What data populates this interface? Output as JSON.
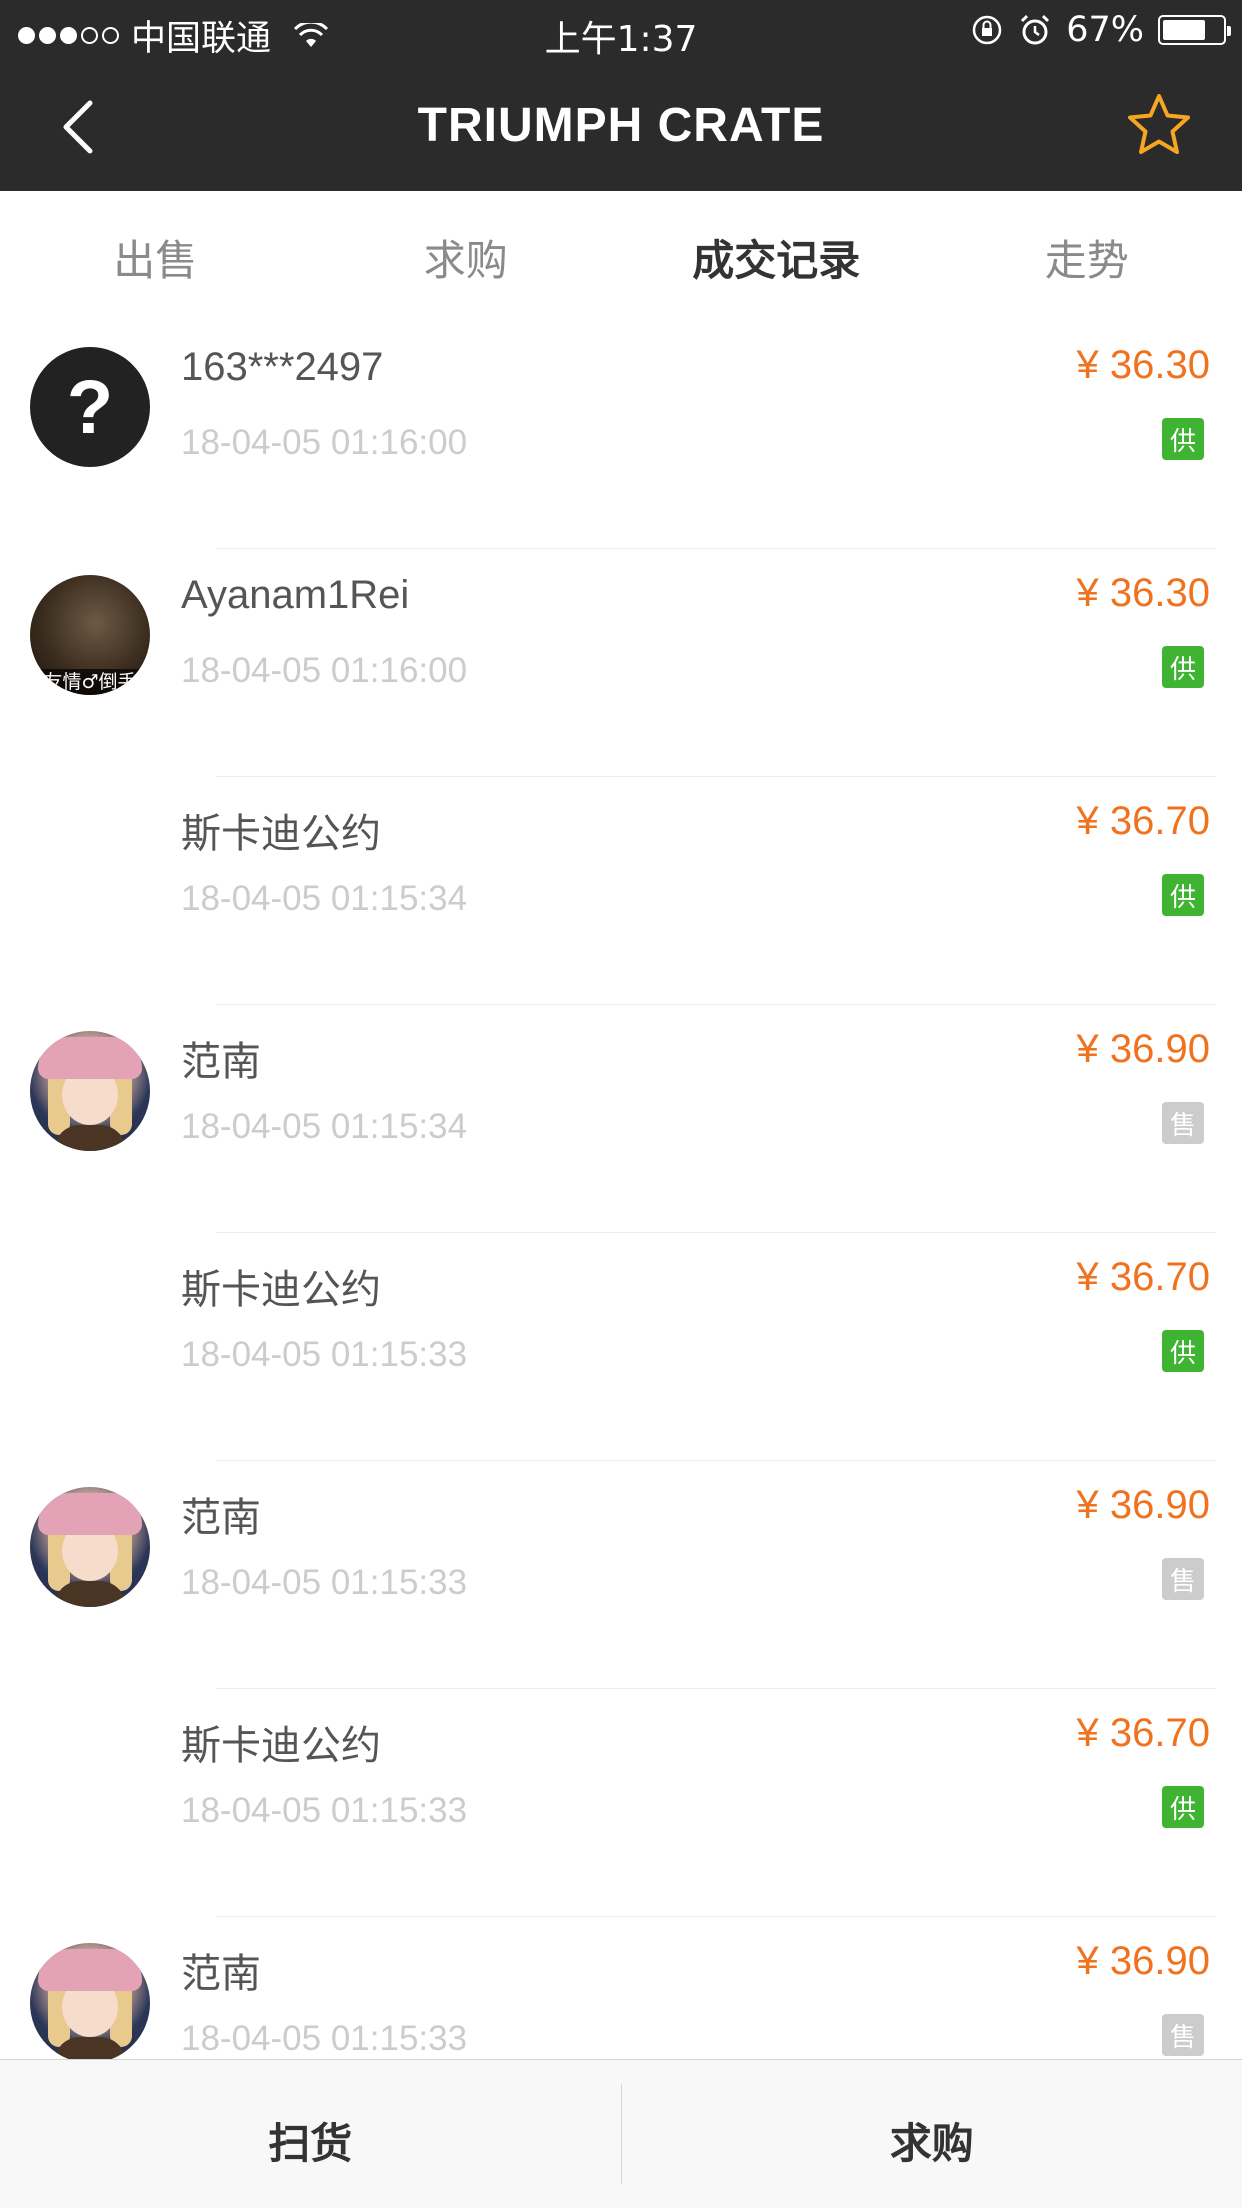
{
  "status_bar": {
    "carrier": "中国联通",
    "time": "上午1:37",
    "battery": "67%",
    "battery_level": 0.67,
    "signal_bars_filled": 3,
    "signal_bars_total": 5,
    "icons": [
      "wifi-icon",
      "rotation-lock-icon",
      "alarm-icon",
      "battery-icon"
    ]
  },
  "nav": {
    "title": "TRIUMPH CRATE",
    "back_icon": "chevron-left-icon",
    "favorite_icon": "star-outline-icon",
    "star_color": "#f5a623"
  },
  "tabs": [
    {
      "label": "出售",
      "active": false
    },
    {
      "label": "求购",
      "active": false
    },
    {
      "label": "成交记录",
      "active": true
    },
    {
      "label": "走势",
      "active": false
    }
  ],
  "records": [
    {
      "name": "163***2497",
      "time": "18-04-05 01:16:00",
      "price": "¥ 36.30",
      "type": "供",
      "avatar": "question-avatar"
    },
    {
      "name": "Ayanam1Rei",
      "time": "18-04-05 01:16:00",
      "price": "¥ 36.30",
      "type": "供",
      "avatar": "photo-avatar",
      "avatar_caption": "友情♂倒手"
    },
    {
      "name": "斯卡迪公约",
      "time": "18-04-05 01:15:34",
      "price": "¥ 36.70",
      "type": "供",
      "avatar": "none"
    },
    {
      "name": "范南",
      "time": "18-04-05 01:15:34",
      "price": "¥ 36.90",
      "type": "售",
      "avatar": "girl-avatar"
    },
    {
      "name": "斯卡迪公约",
      "time": "18-04-05 01:15:33",
      "price": "¥ 36.70",
      "type": "供",
      "avatar": "none"
    },
    {
      "name": "范南",
      "time": "18-04-05 01:15:33",
      "price": "¥ 36.90",
      "type": "售",
      "avatar": "girl-avatar"
    },
    {
      "name": "斯卡迪公约",
      "time": "18-04-05 01:15:33",
      "price": "¥ 36.70",
      "type": "供",
      "avatar": "none"
    },
    {
      "name": "范南",
      "time": "18-04-05 01:15:33",
      "price": "¥ 36.90",
      "type": "售",
      "avatar": "girl-avatar"
    }
  ],
  "colors": {
    "price": "#f0721f",
    "badge_supply": "#3fb433",
    "badge_sell": "#cccccc",
    "header_bg": "#2b2b2b"
  },
  "bottom_bar": {
    "left_label": "扫货",
    "right_label": "求购"
  }
}
